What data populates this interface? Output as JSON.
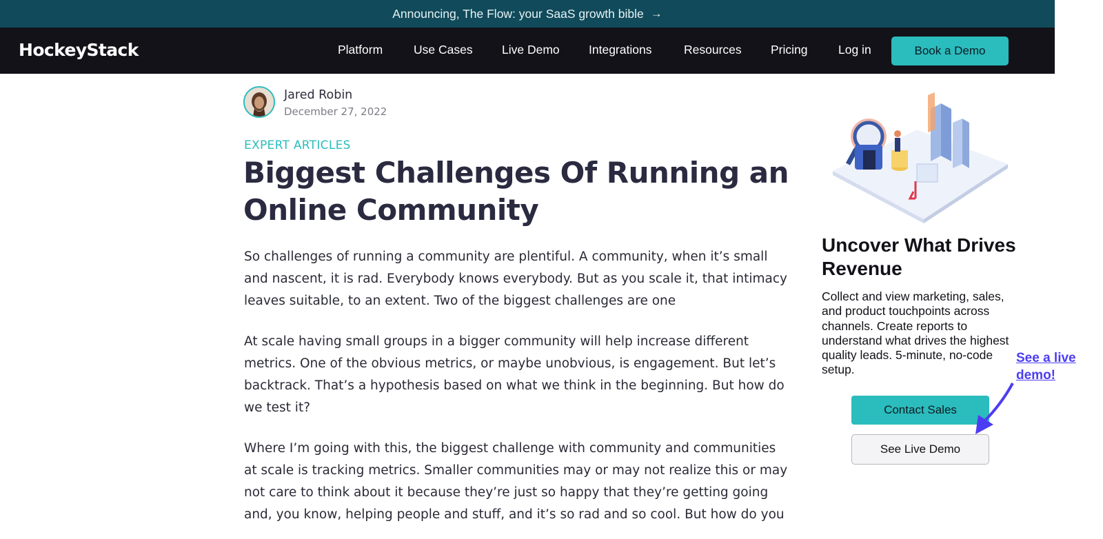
{
  "announcement": {
    "text": "Announcing, The Flow: your SaaS growth bible",
    "arrow": "→"
  },
  "nav": {
    "logo": "HockeyStack",
    "items": [
      "Platform",
      "Use Cases",
      "Live Demo",
      "Integrations",
      "Resources",
      "Pricing",
      "Log in"
    ],
    "cta": "Book a Demo"
  },
  "article": {
    "author": "Jared Robin",
    "date": "December 27, 2022",
    "category": "EXPERT ARTICLES",
    "title": "Biggest Challenges Of Running an Online Community",
    "paragraphs": [
      "So challenges of running a community are plentiful. A community, when it’s small and nascent, it is rad. Everybody knows everybody. But as you scale it, that intimacy leaves suitable, to an extent. Two of the biggest challenges are one",
      "At scale having small groups in a bigger community will help increase different metrics. One of the obvious metrics, or maybe unobvious, is engagement. But let’s backtrack. That’s a hypothesis based on what we think in the beginning. But how do we test it?",
      "Where I’m going with this, the biggest challenge with community and communities at scale is tracking metrics. Smaller communities may or may not realize this or may not care to think about it because they’re just so happy that they’re getting going and, you know, helping people and stuff, and it’s so rad and so cool. But how do you"
    ]
  },
  "sidebar": {
    "title": "Uncover What Drives Revenue",
    "description": "Collect and view marketing, sales, and product touchpoints across channels. Create reports to understand what drives the highest quality leads. 5-minute, no-code setup.",
    "contact_label": "Contact Sales",
    "demo_label": "See Live Demo"
  },
  "annotation": {
    "text": "See a live demo!"
  },
  "colors": {
    "accent": "#2bbcbd",
    "announce_bg": "#114a5a",
    "nav_bg": "#121218",
    "annotation": "#4d3df2"
  }
}
